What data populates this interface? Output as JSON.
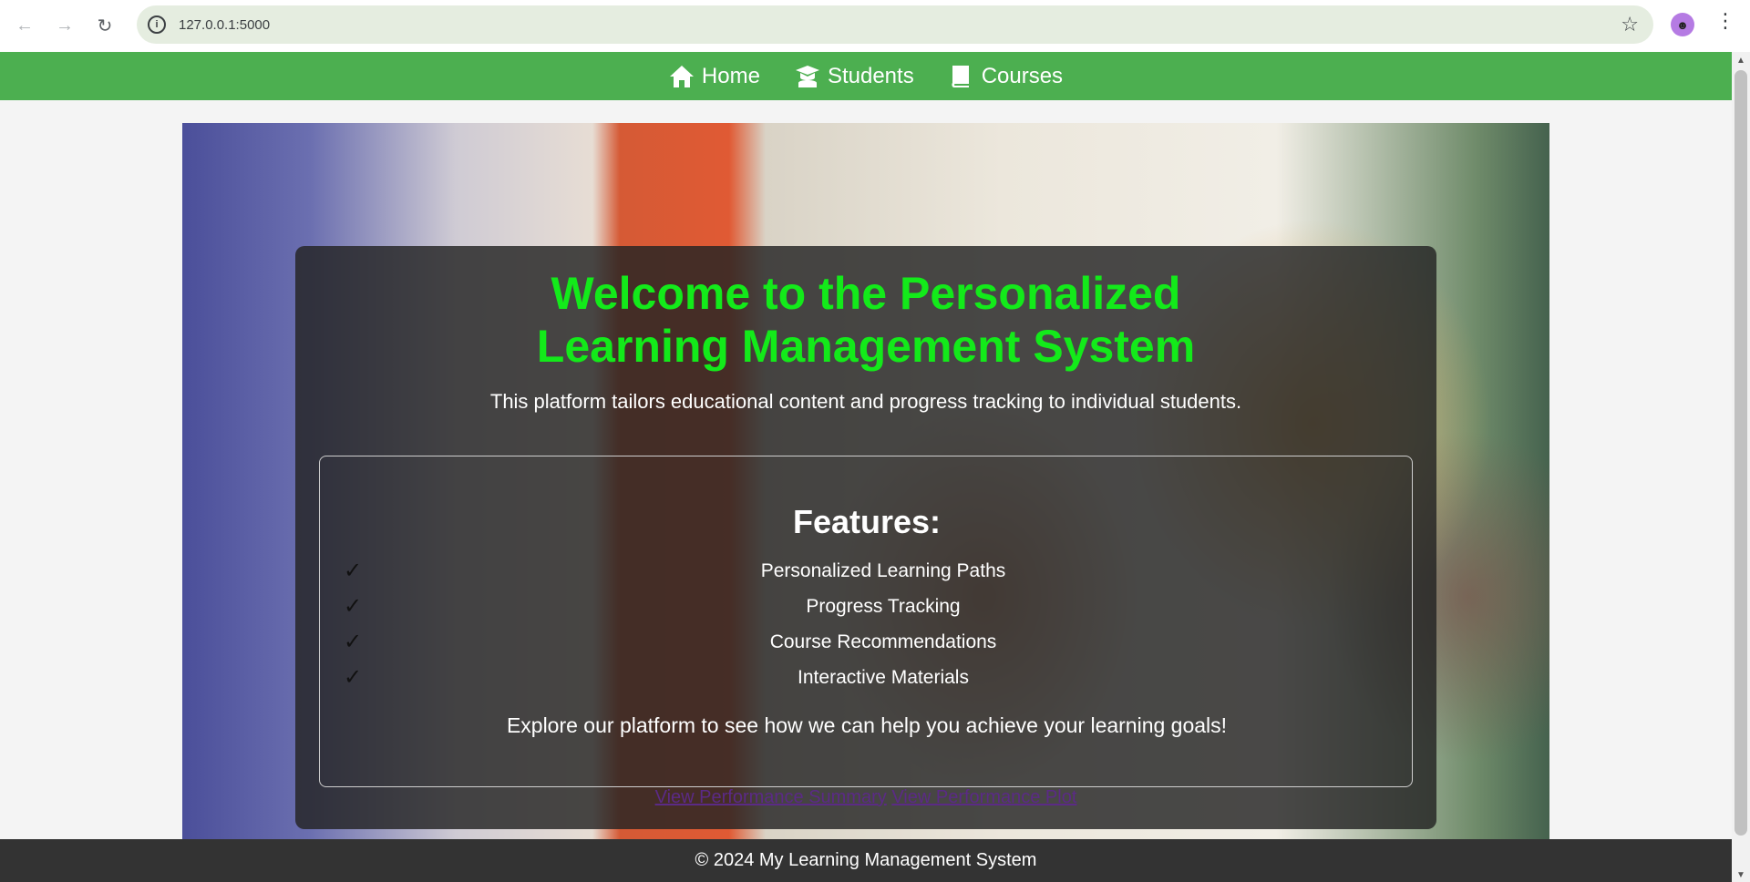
{
  "browser": {
    "url": "127.0.0.1:5000",
    "back_icon": "←",
    "forward_icon": "→",
    "reload_icon": "↻",
    "info_icon": "i",
    "star_icon": "☆",
    "profile_icon": "☻",
    "menu_icon": "⋮"
  },
  "nav": {
    "items": [
      {
        "label": "Home",
        "icon": "home-icon"
      },
      {
        "label": "Students",
        "icon": "graduate-icon"
      },
      {
        "label": "Courses",
        "icon": "book-icon"
      }
    ],
    "background_color": "#4caf50"
  },
  "hero": {
    "title": "Welcome to the Personalized Learning Management System",
    "subtitle": "This platform tailors educational content and progress tracking to individual students.",
    "title_color": "#13ea1a"
  },
  "features": {
    "heading": "Features:",
    "check_icon": "✓",
    "items": [
      "Personalized Learning Paths",
      "Progress Tracking",
      "Course Recommendations",
      "Interactive Materials"
    ],
    "explore_text": "Explore our platform to see how we can help you achieve your learning goals!"
  },
  "links": {
    "summary": "View Performance Summary",
    "plot": "View Performance Plot"
  },
  "footer": {
    "text": "© 2024 My Learning Management System"
  },
  "scrollbar": {
    "up_arrow": "▲",
    "down_arrow": "▼"
  }
}
